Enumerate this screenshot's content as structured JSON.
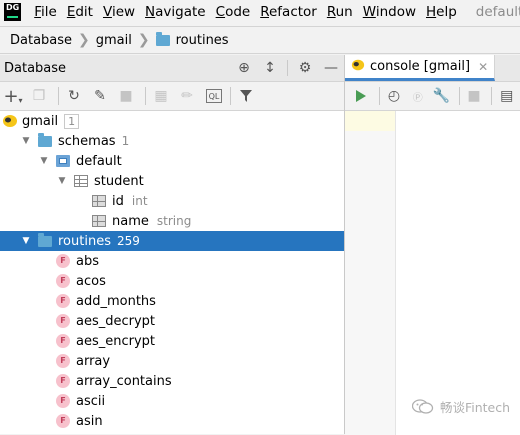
{
  "menubar": {
    "logo_text": "DG",
    "items": [
      {
        "label": "File",
        "mnemonic": "F",
        "rest": "ile"
      },
      {
        "label": "Edit",
        "mnemonic": "E",
        "rest": "dit"
      },
      {
        "label": "View",
        "mnemonic": "V",
        "rest": "iew"
      },
      {
        "label": "Navigate",
        "mnemonic": "N",
        "rest": "avigate"
      },
      {
        "label": "Code",
        "mnemonic": "C",
        "rest": "ode"
      },
      {
        "label": "Refactor",
        "mnemonic": "R",
        "rest": "efactor"
      },
      {
        "label": "Run",
        "mnemonic": "R",
        "rest": "un",
        "mnemonic_index": 1
      },
      {
        "label": "Window",
        "mnemonic": "W",
        "rest": "indow"
      },
      {
        "label": "Help",
        "mnemonic": "H",
        "rest": "elp"
      }
    ],
    "window_title": "default - c"
  },
  "breadcrumb": {
    "items": [
      "Database",
      "gmail",
      "routines"
    ]
  },
  "db_panel": {
    "title": "Database"
  },
  "tree": {
    "gmail": {
      "label": "gmail",
      "count": "1"
    },
    "schemas": {
      "label": "schemas",
      "count": "1"
    },
    "default": {
      "label": "default"
    },
    "student": {
      "label": "student"
    },
    "col_id": {
      "label": "id",
      "type": "int"
    },
    "col_name": {
      "label": "name",
      "type": "string"
    },
    "routines": {
      "label": "routines",
      "count": "259"
    },
    "functions": [
      "abs",
      "acos",
      "add_months",
      "aes_decrypt",
      "aes_encrypt",
      "array",
      "array_contains",
      "ascii",
      "asin"
    ],
    "function_badge": "F"
  },
  "editor": {
    "tab_label": "console [gmail]"
  },
  "watermark": {
    "text": "畅谈Fintech"
  },
  "colors": {
    "selection": "#2675bf",
    "run_green": "#499c54",
    "folder_blue": "#5fa8d3",
    "function_pink": "#f7c1cc"
  }
}
